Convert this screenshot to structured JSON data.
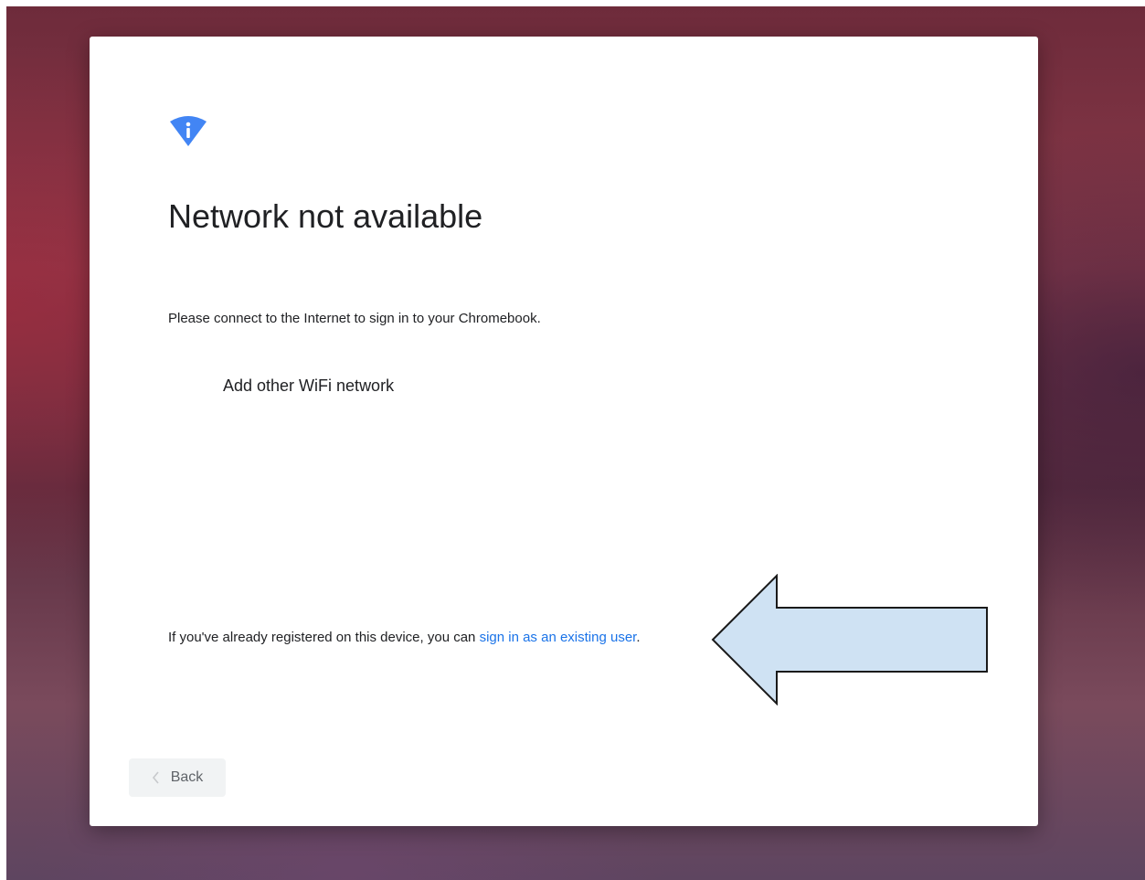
{
  "dialog": {
    "title": "Network not available",
    "subtitle": "Please connect to the Internet to sign in to your Chromebook.",
    "add_network_label": "Add other WiFi network",
    "existing_user_prefix": "If you've already registered on this device, you can ",
    "existing_user_link": "sign in as an existing user",
    "existing_user_suffix": ".",
    "back_label": "Back"
  },
  "icons": {
    "header": "wifi-info-icon",
    "back": "chevron-left-icon",
    "annotation": "arrow-left-annotation"
  },
  "colors": {
    "accent": "#4285f4",
    "link": "#1a73e8",
    "arrow_fill": "#cfe2f3",
    "text": "#202124"
  }
}
